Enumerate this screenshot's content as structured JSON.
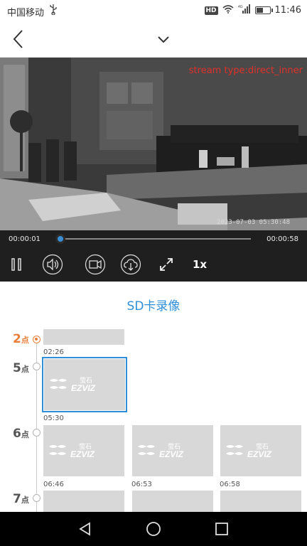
{
  "status_bar": {
    "carrier": "中国移动",
    "usb_icon": "usb-icon",
    "hd_badge": "HD",
    "signal": "4G",
    "time": "11:46"
  },
  "header": {
    "back_icon": "back-arrow-icon",
    "menu_icon": "chevron-down-icon"
  },
  "video": {
    "stream_type": "stream type:direct_inner",
    "osd_timestamp": "2023-07-03  05:30:48"
  },
  "player": {
    "current_time": "00:00:01",
    "end_time": "00:00:58",
    "progress": 0.02,
    "speed": "1x",
    "buttons": [
      "pause-icon",
      "volume-icon",
      "record-icon",
      "download-icon",
      "fullscreen-icon"
    ]
  },
  "sd": {
    "title": "SD卡录像",
    "hours": [
      {
        "hour": "2",
        "unit": "点",
        "active": true
      },
      {
        "hour": "5",
        "unit": "点",
        "active": false
      },
      {
        "hour": "6",
        "unit": "点",
        "active": false
      },
      {
        "hour": "7",
        "unit": "点",
        "active": false
      }
    ],
    "clips": [
      {
        "time": "02:26"
      },
      {
        "time": "05:30"
      },
      {
        "time": "06:46"
      },
      {
        "time": "06:53"
      },
      {
        "time": "06:58"
      }
    ],
    "logo_text": "EZVIZ",
    "logo_cn": "萤石"
  },
  "nav_bar": {
    "back": "nav-back-icon",
    "home": "nav-home-icon",
    "recents": "nav-recents-icon"
  },
  "colors": {
    "accent": "#2e8fd8",
    "active_hour": "#e87e3b",
    "stream_text": "#e0302a"
  }
}
